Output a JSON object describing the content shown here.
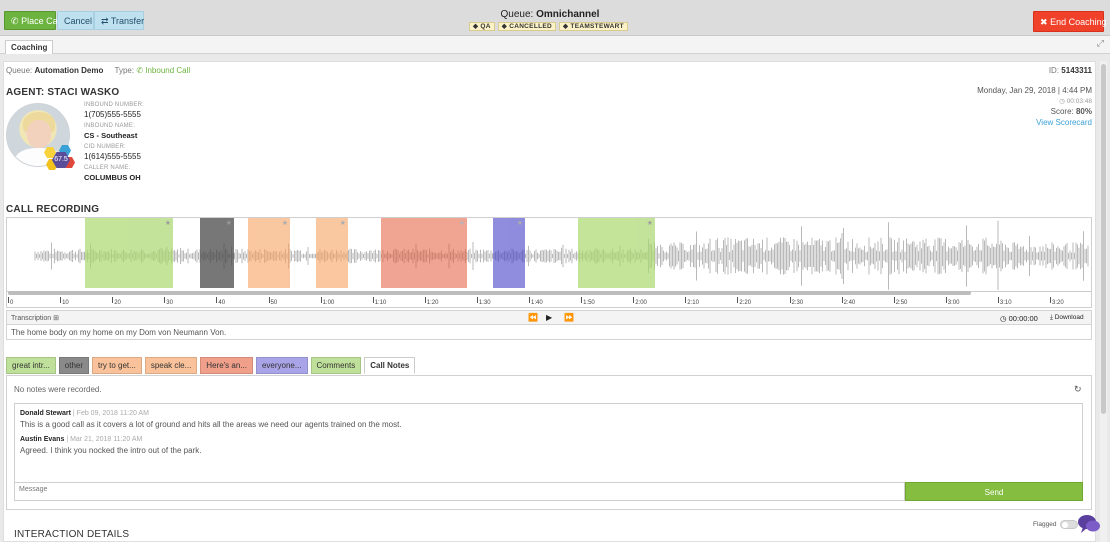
{
  "toolbar": {
    "place_call": "Place Call",
    "cancel": "Cancel",
    "transfer": "Transfer",
    "end_coaching": "End Coaching"
  },
  "queue": {
    "label": "Queue:",
    "name": "Omnichannel",
    "tags": [
      "QA",
      "CANCELLED",
      "TEAMSTEWART"
    ]
  },
  "tab": {
    "label": "Coaching"
  },
  "meta": {
    "queue_label": "Queue:",
    "queue_value": "Automation Demo",
    "type_label": "Type:",
    "type_value": "Inbound Call",
    "id_label": "ID:",
    "id_value": "5143311"
  },
  "agent": {
    "title": "AGENT: STACI WASKO",
    "score_badge": "67.5",
    "fields": [
      {
        "label": "INBOUND NUMBER:",
        "value": "1(705)555-5555"
      },
      {
        "label": "INBOUND NAME:",
        "value": "CS - Southeast"
      },
      {
        "label": "CID NUMBER:",
        "value": "1(614)555-5555"
      },
      {
        "label": "CALLER NAME:",
        "value": "COLUMBUS OH"
      }
    ],
    "datetime": "Monday, Jan 29, 2018 | 4:44 PM",
    "duration": "00:03:48",
    "score_label": "Score:",
    "score_value": "80%",
    "view_scorecard": "View Scorecard"
  },
  "recording": {
    "title": "CALL RECORDING",
    "ticks": [
      "0",
      "10",
      "20",
      "30",
      "40",
      "50",
      "1:00",
      "1:10",
      "1:20",
      "1:30",
      "1:40",
      "1:50",
      "2:00",
      "2:10",
      "2:20",
      "2:30",
      "2:40",
      "2:50",
      "3:00",
      "3:10",
      "3:20"
    ],
    "segments": [
      {
        "color": "#a9d86e",
        "opacity": 0.7
      },
      {
        "color": "#4a4a4a",
        "opacity": 0.75
      },
      {
        "color": "#f6a262",
        "opacity": 0.6
      },
      {
        "color": "#f6a262",
        "opacity": 0.6
      },
      {
        "color": "#e45a3a",
        "opacity": 0.55
      },
      {
        "color": "#4640c8",
        "opacity": 0.6
      },
      {
        "color": "#a9d86e",
        "opacity": 0.7
      }
    ],
    "transcription_label": "Transcription",
    "time": "00:00:00",
    "download": "Download",
    "transcript": "The home body on my home on my Dom von Neumann Von."
  },
  "segtabs": [
    {
      "label": "great intr...",
      "color": "#bfe09a"
    },
    {
      "label": "other",
      "color": "#8a8a8a"
    },
    {
      "label": "try to get...",
      "color": "#f9c29a"
    },
    {
      "label": "speak cle...",
      "color": "#f9c29a"
    },
    {
      "label": "Here's an...",
      "color": "#ef9f8a"
    },
    {
      "label": "everyone...",
      "color": "#a9a4e8"
    },
    {
      "label": "Comments",
      "color": "#bfe09a"
    },
    {
      "label": "Call Notes",
      "color": "#ffffff"
    }
  ],
  "notes": {
    "empty": "No notes were recorded.",
    "comments": [
      {
        "author": "Donald Stewart",
        "date": "| Feb 09, 2018 11:20 AM",
        "text": "This is a good call as it covers a lot of ground and hits all the areas we need our agents trained on the most."
      },
      {
        "author": "Austin Evans",
        "date": "| Mar 21, 2018 11:20 AM",
        "text": "Agreed. I think you nocked the intro out of the park."
      }
    ],
    "message_placeholder": "Message",
    "send": "Send"
  },
  "interaction": {
    "title": "INTERACTION DETAILS",
    "flagged": "Flagged"
  },
  "icons": [
    "phone-icon",
    "transfer-icon",
    "tag-icon",
    "clock-icon",
    "rewind-icon",
    "play-icon",
    "forward-icon",
    "download-icon",
    "refresh-icon",
    "chat-icon",
    "expand-icon",
    "star-icon"
  ]
}
